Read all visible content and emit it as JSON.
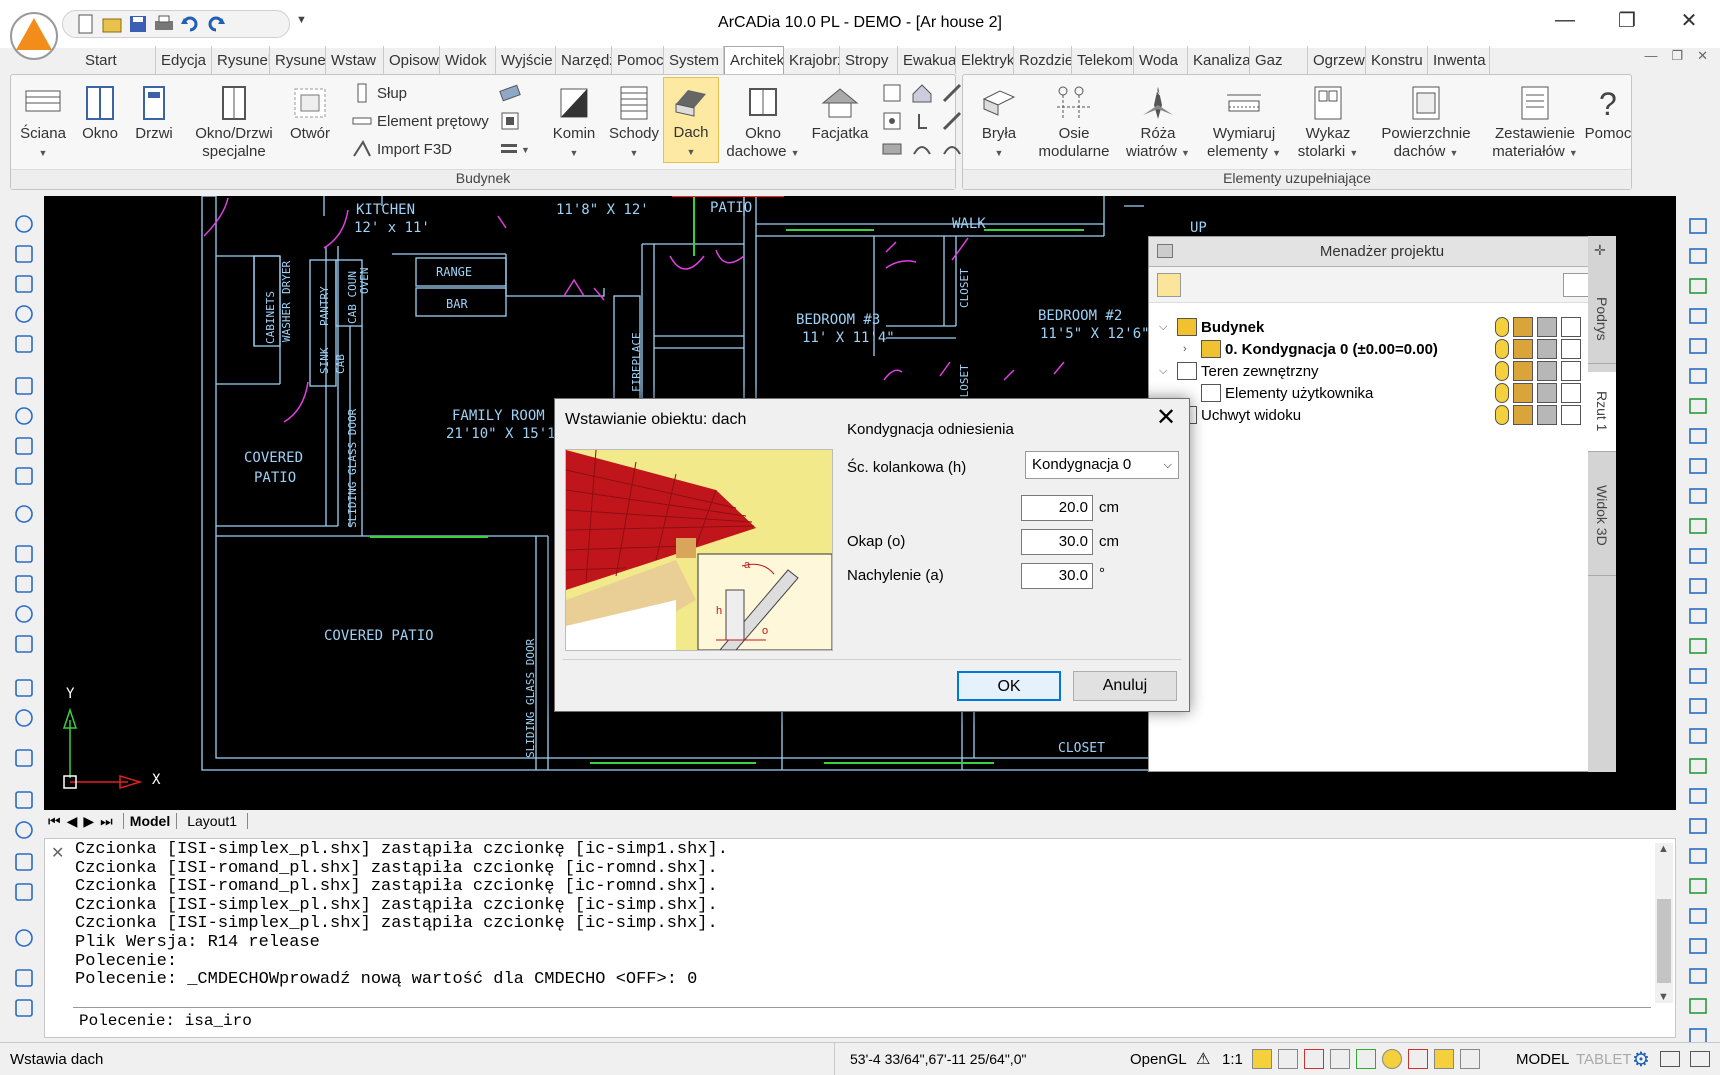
{
  "window": {
    "title": "ArCADia 10.0 PL - DEMO  - [Ar house 2]",
    "controls": [
      "minimize-icon",
      "restore-icon",
      "close-icon"
    ]
  },
  "menu_tabs": [
    "Start",
    "Edycja",
    "Rysunel",
    "Rysunel",
    "Wstaw",
    "Opisow",
    "Widok",
    "Wyjście",
    "Narzędz",
    "Pomoc",
    "System",
    "Architek",
    "Krajobrz",
    "Stropy",
    "Ewakua",
    "Elektryk",
    "Rozdzie",
    "Telekom",
    "Woda",
    "Kanaliza",
    "Gaz",
    "Ogrzew",
    "Konstru",
    "Inwenta"
  ],
  "active_menu_tab": "Architek",
  "ribbon": {
    "panel_budynek": "Budynek",
    "panel_elementy": "Elementy uzupełniające",
    "btn_sciana": "Ściana",
    "btn_okno": "Okno",
    "btn_drzwi": "Drzwi",
    "btn_okno_drzwi_1": "Okno/Drzwi",
    "btn_okno_drzwi_2": "specjalne",
    "btn_otwor": "Otwór",
    "btn_slup": "Słup",
    "btn_element_pretowy": "Element prętowy",
    "btn_import_f3d": "Import F3D",
    "btn_komin": "Komin",
    "btn_schody": "Schody",
    "btn_dach": "Dach",
    "btn_okno_dachowe_1": "Okno",
    "btn_okno_dachowe_2": "dachowe",
    "btn_facjatka": "Facjatka",
    "btn_bryla": "Bryła",
    "btn_osie_1": "Osie",
    "btn_osie_2": "modularne",
    "btn_roza_1": "Róża",
    "btn_roza_2": "wiatrów",
    "btn_wymiaruj_1": "Wymiaruj",
    "btn_wymiaruj_2": "elementy",
    "btn_wykaz_1": "Wykaz",
    "btn_wykaz_2": "stolarki",
    "btn_powierzchnie_1": "Powierzchnie",
    "btn_powierzchnie_2": "dachów",
    "btn_zestawienie_1": "Zestawienie",
    "btn_zestawienie_2": "materiałów",
    "btn_pomoc": "Pomoc"
  },
  "drawing": {
    "labels": {
      "kitchen": "KITCHEN",
      "kitchen_size": "12' x 11'",
      "size_top": "11'8\" X 12'",
      "patio": "PATIO",
      "walk": "WALK",
      "up": "UP",
      "range": "RANGE",
      "bar": "BAR",
      "cabinets": "CABINETS",
      "washer": "WASHER",
      "dryer": "DRYER",
      "pantry": "PANTRY",
      "sink": "SINK",
      "cab": "CAB",
      "cab_coun": "CAB COUN",
      "oven": "OVEN",
      "bedroom3": "BEDROOM #3",
      "bedroom3_size": "11' X 11'4\"",
      "bedroom2": "BEDROOM #2",
      "bedroom2_size": "11'5\" X 12'6\"",
      "closet": "CLOSET",
      "fireplace": "FIREPLACE",
      "family_room": "FAMILY ROOM",
      "family_room_size": "21'10\" X 15'10",
      "covered_patio_1": "COVERED",
      "covered_patio_2": "PATIO",
      "sliding_door": "SLIDING GLASS DOOR",
      "covered_patio_big": "COVERED PATIO",
      "closet_bottom": "CLOSET",
      "axis_y": "Y",
      "axis_x": "X"
    }
  },
  "layout_tabs": [
    "Model",
    "Layout1"
  ],
  "active_layout_tab": "Model",
  "command_lines": [
    "Czcionka [ISI-simplex_pl.shx] zastąpiła czcionkę [ic-simp1.shx].",
    "Czcionka [ISI-romand_pl.shx] zastąpiła czcionkę [ic-romnd.shx].",
    "Czcionka [ISI-romand_pl.shx] zastąpiła czcionkę [ic-romnd.shx].",
    "Czcionka [ISI-simplex_pl.shx] zastąpiła czcionkę [ic-simp.shx].",
    "Czcionka [ISI-simplex_pl.shx] zastąpiła czcionkę [ic-simp.shx].",
    "Plik Wersja: R14 release",
    "Polecenie:",
    "Polecenie: _CMDECHOWprowadź nową wartość dla CMDECHO <OFF>: 0"
  ],
  "command_input": "Polecenie: isa_iro",
  "status": {
    "message": "Wstawia dach",
    "coords": "53'-4 33/64\",67'-11 25/64\",0\"",
    "renderer": "OpenGL",
    "scale": "1:1",
    "model": "MODEL",
    "tablet": "TABLET"
  },
  "project_manager": {
    "title": "Menadżer projektu",
    "tree": [
      {
        "label": "Budynek",
        "level": 0,
        "expanded": true
      },
      {
        "label": "0. Kondygnacja 0 (±0.00=0.00)",
        "level": 1,
        "expanded": false
      },
      {
        "label": "Teren zewnętrzny",
        "level": 0,
        "expanded": true
      },
      {
        "label": "Elementy użytkownika",
        "level": 1
      },
      {
        "label": "Uchwyt widoku",
        "level": 0
      }
    ],
    "side_tabs": [
      "Podrys",
      "Rzut 1",
      "Widok 3D"
    ]
  },
  "dialog": {
    "title": "Wstawianie obiektu: dach",
    "fields": {
      "level_label": "Kondygnacja odniesienia",
      "level_value": "Kondygnacja 0",
      "knee_label": "Śc. kolankowa (h)",
      "knee_value": "20.0",
      "knee_unit": "cm",
      "eave_label": "Okap (o)",
      "eave_value": "30.0",
      "eave_unit": "cm",
      "slope_label": "Nachylenie (a)",
      "slope_value": "30.0",
      "slope_unit": "°"
    },
    "diagram_labels": {
      "a": "a",
      "h": "h",
      "o": "o"
    },
    "ok": "OK",
    "cancel": "Anuluj"
  },
  "colors": {
    "cad_bg": "#000000",
    "cad_lines": "#9ed1f5",
    "cad_door": "#e040e0",
    "cad_window": "#3ad13a",
    "roof_red": "#c0161b",
    "accent_blue": "#0078d7",
    "logo_orange": "#f28c1a"
  }
}
